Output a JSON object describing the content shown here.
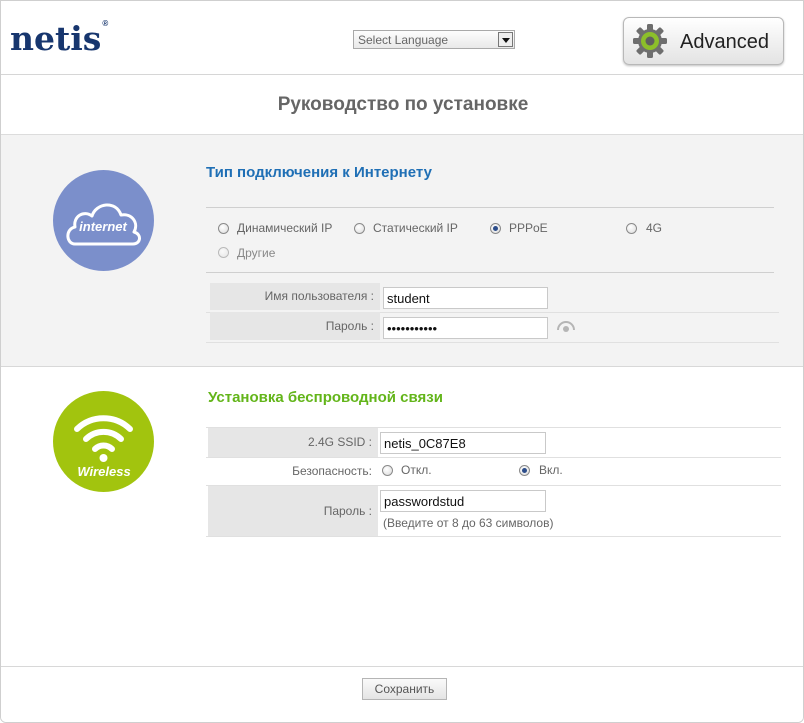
{
  "header": {
    "logo_text": "netis",
    "logo_mark": "®",
    "language_select": {
      "selected": "Select Language"
    },
    "advanced_button_label": "Advanced",
    "advanced_icon": "gear-icon"
  },
  "page_title": "Руководство по установке",
  "internet_section": {
    "icon_label": "internet",
    "title": "Тип подключения к Интернету",
    "connection_types": [
      {
        "label": "Динамический IP",
        "selected": false
      },
      {
        "label": "Статический IP",
        "selected": false
      },
      {
        "label": "PPPoE",
        "selected": true
      },
      {
        "label": "4G",
        "selected": false
      },
      {
        "label": "Другие",
        "selected": false
      }
    ],
    "username_label": "Имя пользователя :",
    "username_value": "student",
    "password_label": "Пароль :",
    "password_value": "•••••••••••",
    "show_password_icon": "eye-icon"
  },
  "wireless_section": {
    "icon_label": "Wireless",
    "title": "Установка беспроводной связи",
    "ssid_label": "2.4G SSID :",
    "ssid_value": "netis_0C87E8",
    "security_label": "Безопасность:",
    "security_options": [
      {
        "label": "Откл.",
        "selected": false
      },
      {
        "label": "Вкл.",
        "selected": true
      }
    ],
    "password_label": "Пароль :",
    "password_value": "passwordstud",
    "password_hint": "(Введите от 8 до 63 символов)"
  },
  "footer": {
    "save_label": "Сохранить"
  },
  "colors": {
    "brand": "#17366e",
    "internet_accent": "#1f6fb5",
    "internet_icon_bg": "#7b8fcb",
    "wireless_accent": "#63b51a",
    "wireless_icon_bg": "#a2c40e"
  }
}
